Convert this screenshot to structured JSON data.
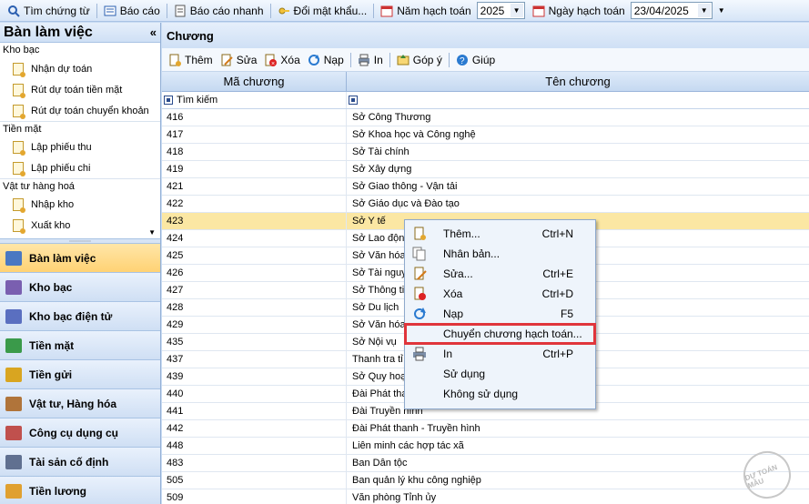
{
  "topbar": {
    "items": [
      {
        "label": "Tìm chứng từ",
        "icon": "search-icon"
      },
      {
        "label": "Báo cáo",
        "icon": "report-icon"
      },
      {
        "label": "Báo cáo nhanh",
        "icon": "quick-report-icon"
      },
      {
        "label": "Đổi mật khẩu...",
        "icon": "key-icon"
      }
    ],
    "year_label": "Năm hạch toán",
    "year_value": "2025",
    "date_label": "Ngày hạch toán",
    "date_value": "23/04/2025"
  },
  "sidebar": {
    "title": "Bàn làm việc",
    "collapse": "«",
    "groups": [
      {
        "name": "Kho bạc",
        "items": [
          "Nhận dự toán",
          "Rút dự toán tiền mặt",
          "Rút dự toán chuyển khoản"
        ]
      },
      {
        "name": "Tiền mặt",
        "items": [
          "Lập phiếu thu",
          "Lập phiếu chi"
        ]
      },
      {
        "name": "Vật tư hàng hoá",
        "items": [
          "Nhập kho",
          "Xuất kho"
        ]
      }
    ],
    "nav": [
      "Bàn làm việc",
      "Kho bạc",
      "Kho bạc điện tử",
      "Tiền mặt",
      "Tiền gửi",
      "Vật tư, Hàng hóa",
      "Công cụ dụng cụ",
      "Tài sản cố định",
      "Tiền lương"
    ],
    "nav_active": 0
  },
  "main": {
    "title": "Chương",
    "toolbar": [
      "Thêm",
      "Sửa",
      "Xóa",
      "Nạp",
      "In",
      "Góp ý",
      "Giúp"
    ],
    "columns": [
      "Mã chương",
      "Tên chương"
    ],
    "filter_placeholder": "Tìm kiếm",
    "selected_row": 6,
    "rows": [
      [
        "416",
        "Sở Công Thương"
      ],
      [
        "417",
        "Sở Khoa học và Công nghệ"
      ],
      [
        "418",
        "Sở Tài chính"
      ],
      [
        "419",
        "Sở Xây dựng"
      ],
      [
        "421",
        "Sở Giao thông - Vận tải"
      ],
      [
        "422",
        "Sở Giáo dục và Đào tạo"
      ],
      [
        "423",
        "Sở Y tế"
      ],
      [
        "424",
        "Sở Lao động"
      ],
      [
        "425",
        "Sở Văn hóa"
      ],
      [
        "426",
        "Sở Tài nguy"
      ],
      [
        "427",
        "Sở Thông tin"
      ],
      [
        "428",
        "Sở Du lịch"
      ],
      [
        "429",
        "Sở Văn hóa"
      ],
      [
        "435",
        "Sở Nội vụ"
      ],
      [
        "437",
        "Thanh tra tỉ"
      ],
      [
        "439",
        "Sở Quy hoạ"
      ],
      [
        "440",
        "Đài Phát tha"
      ],
      [
        "441",
        "Đài Truyền hình"
      ],
      [
        "442",
        "Đài Phát thanh - Truyền hình"
      ],
      [
        "448",
        "Liên minh các hợp tác xã"
      ],
      [
        "483",
        "Ban Dân tộc"
      ],
      [
        "505",
        "Ban quản lý khu công nghiệp"
      ],
      [
        "509",
        "Văn phòng Tỉnh ủy"
      ]
    ]
  },
  "context_menu": [
    {
      "label": "Thêm...",
      "shortcut": "Ctrl+N",
      "icon": "add-doc-icon"
    },
    {
      "label": "Nhân bản...",
      "shortcut": "",
      "icon": "duplicate-icon"
    },
    {
      "label": "Sửa...",
      "shortcut": "Ctrl+E",
      "icon": "edit-icon"
    },
    {
      "label": "Xóa",
      "shortcut": "Ctrl+D",
      "icon": "delete-icon"
    },
    {
      "label": "Nạp",
      "shortcut": "F5",
      "icon": "refresh-icon"
    },
    {
      "label": "Chuyển chương hạch toán...",
      "shortcut": "",
      "icon": "none",
      "highlight": true
    },
    {
      "label": "In",
      "shortcut": "Ctrl+P",
      "icon": "print-icon"
    },
    {
      "label": "Sử dụng",
      "shortcut": "",
      "icon": "none"
    },
    {
      "label": "Không sử dụng",
      "shortcut": "",
      "icon": "none"
    }
  ],
  "watermark": "DỰ TOÁN MẪU",
  "colors": {
    "accent": "#ffd274",
    "highlight": "#e0353b",
    "selected_row": "#fbe7a3"
  }
}
